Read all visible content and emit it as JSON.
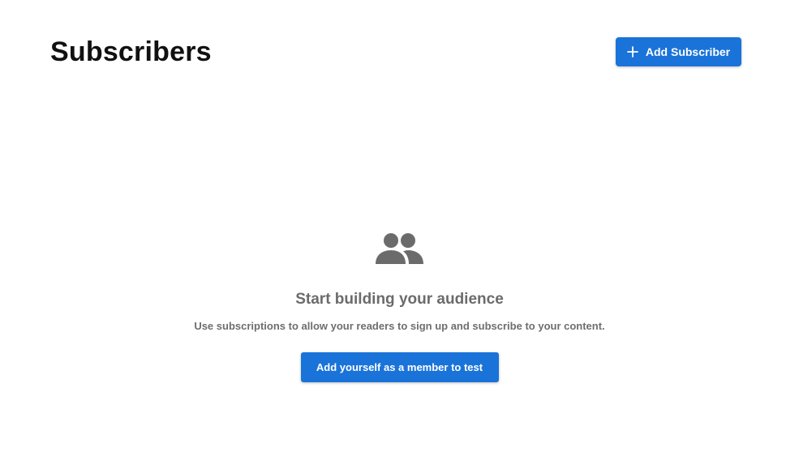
{
  "header": {
    "title": "Subscribers",
    "add_button_label": "Add Subscriber",
    "add_button_icon": "plus-icon"
  },
  "empty_state": {
    "icon": "people-icon",
    "heading": "Start building your audience",
    "description": "Use subscriptions to allow your readers to sign up and subscribe to your content.",
    "cta_label": "Add yourself as a member to test"
  },
  "colors": {
    "accent": "#1a73d9",
    "title": "#111111",
    "muted_text": "#6b6b6b",
    "icon": "#6b6b6b",
    "background": "#ffffff"
  }
}
